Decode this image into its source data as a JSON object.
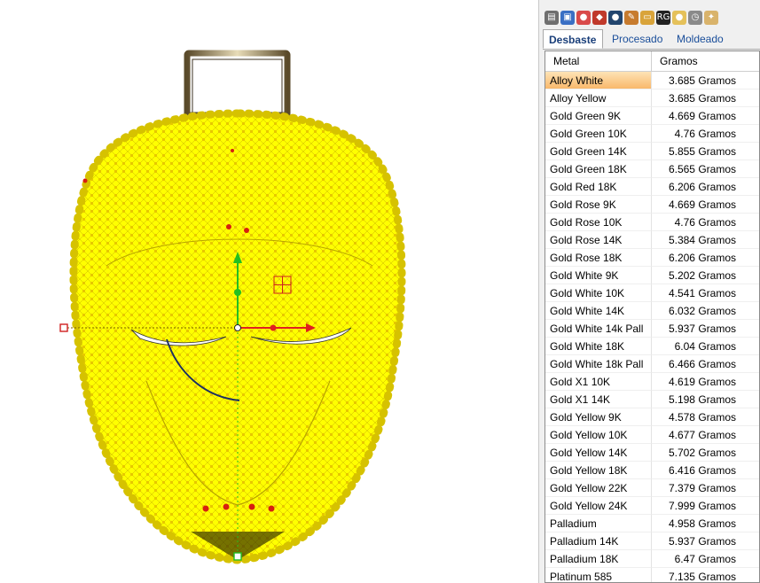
{
  "toolbar": {
    "icons": [
      {
        "name": "print-icon",
        "color": "#6e6e6e",
        "glyph": "▤"
      },
      {
        "name": "monitor-icon",
        "color": "#3a6fc4",
        "glyph": "▣"
      },
      {
        "name": "color-wheel-icon",
        "color": "#d94a4a",
        "glyph": "●"
      },
      {
        "name": "layers-icon",
        "color": "#c0392b",
        "glyph": "◆"
      },
      {
        "name": "bomb-icon",
        "color": "#22456e",
        "glyph": "●"
      },
      {
        "name": "pencil-icon",
        "color": "#c77b2e",
        "glyph": "✎"
      },
      {
        "name": "folder-icon",
        "color": "#d9a43a",
        "glyph": "▭"
      },
      {
        "name": "rg-logo-icon",
        "color": "#222222",
        "glyph": "RG"
      },
      {
        "name": "gold-ball-icon",
        "color": "#e5c15a",
        "glyph": "●"
      },
      {
        "name": "clock-icon",
        "color": "#8a8a8a",
        "glyph": "◷"
      },
      {
        "name": "scroll-icon",
        "color": "#d9b36b",
        "glyph": "✦"
      }
    ]
  },
  "tabs": [
    {
      "label": "Desbaste",
      "active": true
    },
    {
      "label": "Procesado",
      "active": false
    },
    {
      "label": "Moldeado",
      "active": false
    }
  ],
  "table": {
    "headers": {
      "metal": "Metal",
      "weight": "Gramos"
    },
    "rows": [
      {
        "metal": "Alloy White",
        "weight": "3.685 Gramos",
        "selected": true
      },
      {
        "metal": "Alloy Yellow",
        "weight": "3.685 Gramos"
      },
      {
        "metal": "Gold Green 9K",
        "weight": "4.669 Gramos"
      },
      {
        "metal": "Gold Green 10K",
        "weight": "4.76 Gramos"
      },
      {
        "metal": "Gold Green 14K",
        "weight": "5.855 Gramos"
      },
      {
        "metal": "Gold Green 18K",
        "weight": "6.565 Gramos"
      },
      {
        "metal": "Gold Red 18K",
        "weight": "6.206 Gramos"
      },
      {
        "metal": "Gold Rose 9K",
        "weight": "4.669 Gramos"
      },
      {
        "metal": "Gold Rose 10K",
        "weight": "4.76 Gramos"
      },
      {
        "metal": "Gold Rose 14K",
        "weight": "5.384 Gramos"
      },
      {
        "metal": "Gold Rose 18K",
        "weight": "6.206 Gramos"
      },
      {
        "metal": "Gold White 9K",
        "weight": "5.202 Gramos"
      },
      {
        "metal": "Gold White 10K",
        "weight": "4.541 Gramos"
      },
      {
        "metal": "Gold White 14K",
        "weight": "6.032 Gramos"
      },
      {
        "metal": "Gold White 14k Pall",
        "weight": "5.937 Gramos"
      },
      {
        "metal": "Gold White 18K",
        "weight": "6.04 Gramos"
      },
      {
        "metal": "Gold White 18k Pall",
        "weight": "6.466 Gramos"
      },
      {
        "metal": "Gold X1 10K",
        "weight": "4.619 Gramos"
      },
      {
        "metal": "Gold X1 14K",
        "weight": "5.198 Gramos"
      },
      {
        "metal": "Gold Yellow 9K",
        "weight": "4.578 Gramos"
      },
      {
        "metal": "Gold Yellow 10K",
        "weight": "4.677 Gramos"
      },
      {
        "metal": "Gold Yellow 14K",
        "weight": "5.702 Gramos"
      },
      {
        "metal": "Gold Yellow 18K",
        "weight": "6.416 Gramos"
      },
      {
        "metal": "Gold Yellow 22K",
        "weight": "7.379 Gramos"
      },
      {
        "metal": "Gold Yellow 24K",
        "weight": "7.999 Gramos"
      },
      {
        "metal": "Palladium",
        "weight": "4.958 Gramos"
      },
      {
        "metal": "Palladium 14K",
        "weight": "5.937 Gramos"
      },
      {
        "metal": "Palladium 18K",
        "weight": "6.47 Gramos"
      },
      {
        "metal": "Platinum 585",
        "weight": "7.135 Gramos"
      }
    ]
  },
  "colors": {
    "model_yellow": "#ffff00",
    "gizmo_x": "#e02020",
    "gizmo_y": "#22c022",
    "selection_highlight": "#f9b86b"
  }
}
